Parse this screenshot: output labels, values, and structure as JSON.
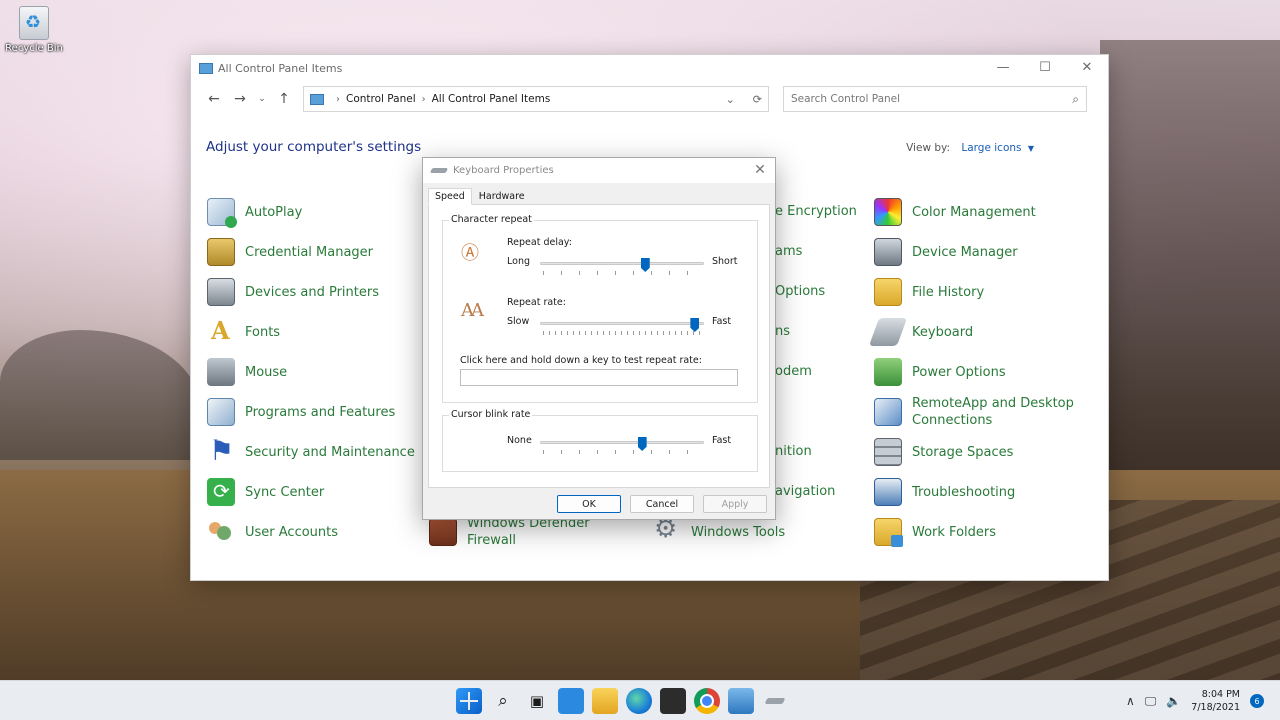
{
  "desktop": {
    "recycle_bin_label": "Recycle Bin"
  },
  "window": {
    "title": "All Control Panel Items",
    "controls": {
      "minimize": "—",
      "maximize": "☐",
      "close": "✕"
    },
    "nav": {
      "back": "←",
      "forward": "→",
      "recent": "⌄",
      "up": "↑"
    },
    "breadcrumb": [
      "Control Panel",
      "All Control Panel Items"
    ],
    "search_placeholder": "Search Control Panel",
    "heading": "Adjust your computer's settings",
    "view_by_label": "View by:",
    "view_by_value": "Large icons"
  },
  "items": {
    "col1": [
      "AutoPlay",
      "Credential Manager",
      "Devices and Printers",
      "Fonts",
      "Mouse",
      "Programs and Features",
      "Security and Maintenance",
      "Sync Center",
      "User Accounts"
    ],
    "col2_partial": [
      "Windows Defender",
      "Firewall"
    ],
    "col3_partial": [
      "e Encryption",
      "ams",
      "Options",
      "ns",
      "odem",
      "nition",
      "avigation",
      "Windows Tools"
    ],
    "col4": [
      "Color Management",
      "Device Manager",
      "File History",
      "Keyboard",
      "Power Options",
      "RemoteApp and Desktop",
      "Connections",
      "Storage Spaces",
      "Troubleshooting",
      "Work Folders"
    ]
  },
  "dialog": {
    "title": "Keyboard Properties",
    "tabs": [
      "Speed",
      "Hardware"
    ],
    "active_tab": "Speed",
    "character_repeat": {
      "group_title": "Character repeat",
      "repeat_delay_label": "Repeat delay:",
      "repeat_delay_min": "Long",
      "repeat_delay_max": "Short",
      "repeat_delay_value": 0.65,
      "repeat_rate_label": "Repeat rate:",
      "repeat_rate_min": "Slow",
      "repeat_rate_max": "Fast",
      "repeat_rate_value": 0.97,
      "test_label": "Click here and hold down a key to test repeat rate:"
    },
    "cursor_blink": {
      "group_title": "Cursor blink rate",
      "min": "None",
      "max": "Fast",
      "value": 0.63
    },
    "buttons": {
      "ok": "OK",
      "cancel": "Cancel",
      "apply": "Apply"
    }
  },
  "taskbar": {
    "time": "8:04 PM",
    "date": "7/18/2021",
    "notification_count": "6",
    "tray_chevron": "∧"
  }
}
